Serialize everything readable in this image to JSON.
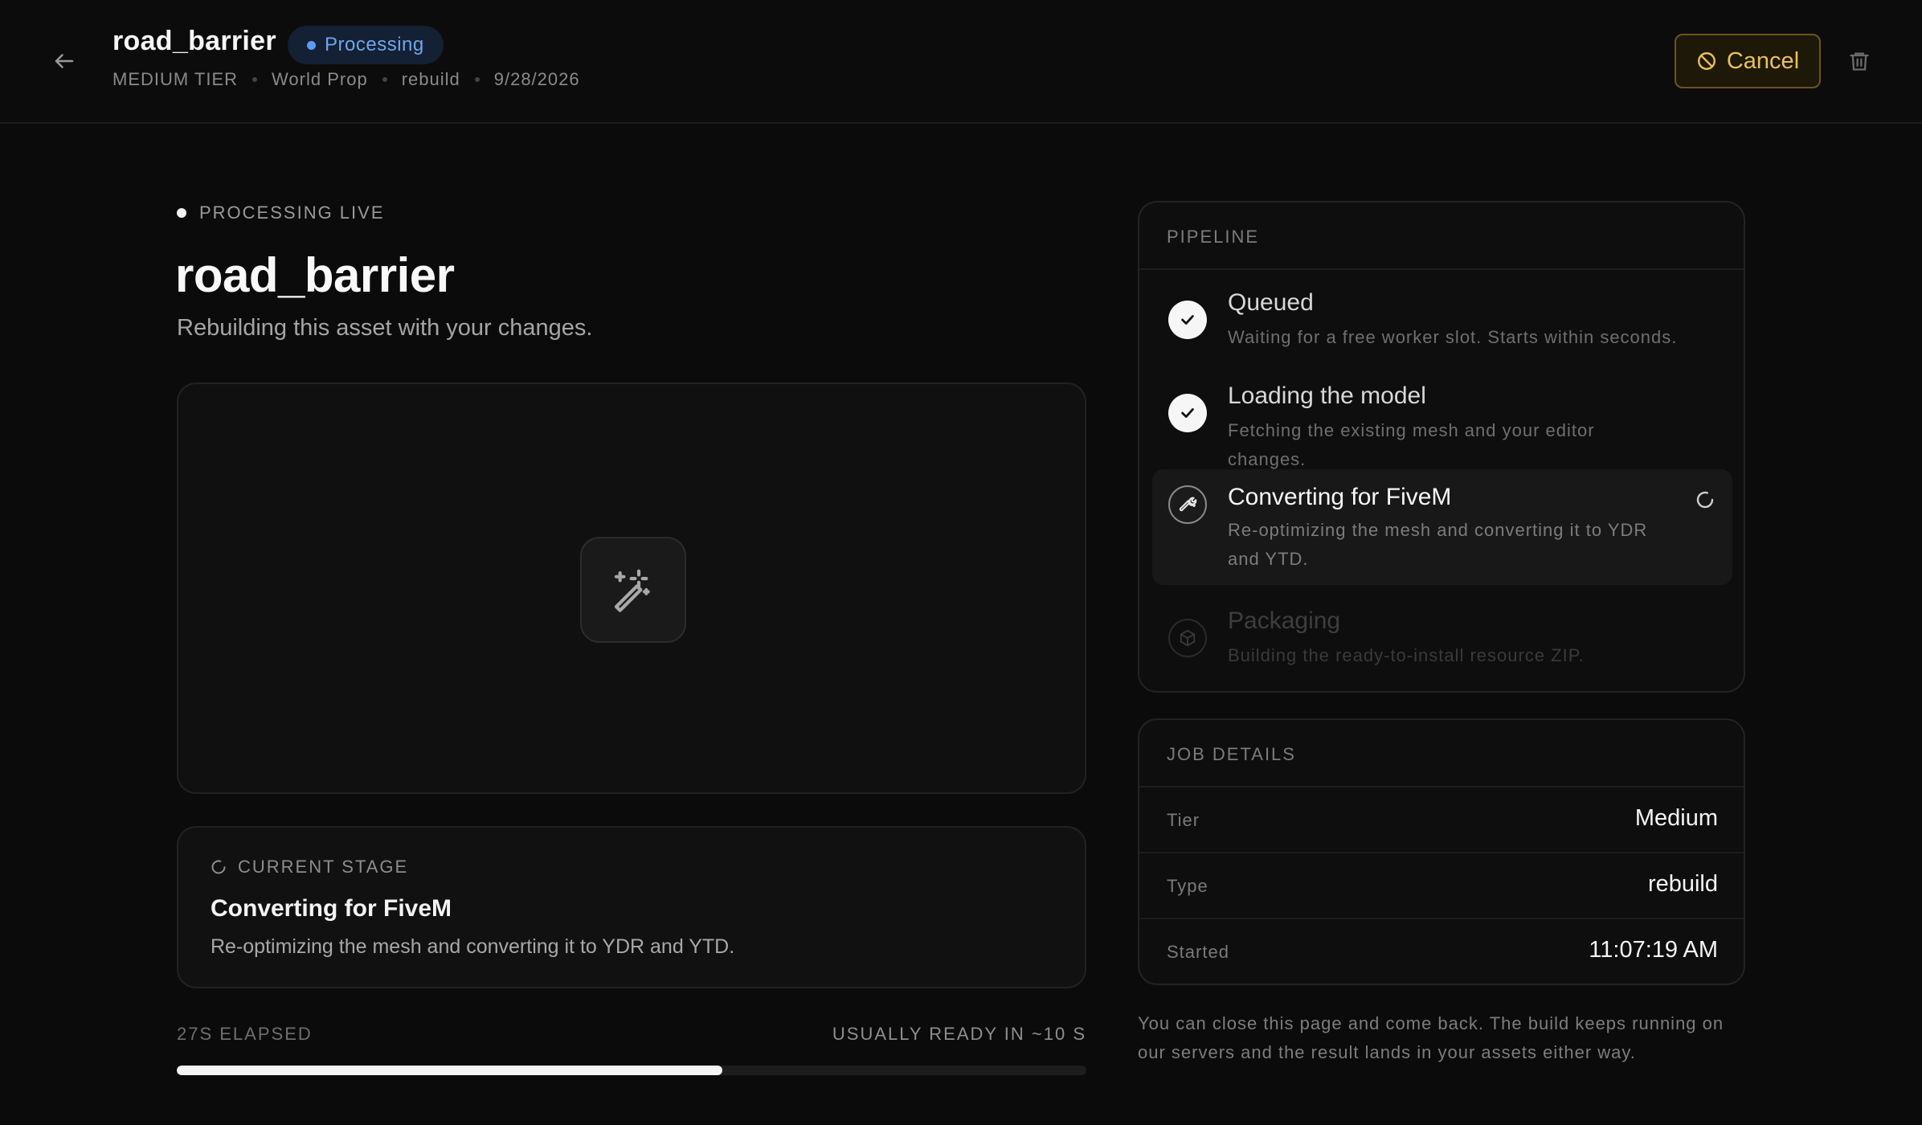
{
  "header": {
    "title": "road_barrier",
    "status": "Processing",
    "meta": [
      "MEDIUM TIER",
      "World Prop",
      "rebuild",
      "9/28/2026"
    ],
    "cancel_label": "Cancel",
    "icons": {
      "back": "arrow-left-icon",
      "cancel": "ban-icon",
      "delete": "trash-icon"
    },
    "colors": {
      "status_accent": "#5b9cf0",
      "cancel_accent": "#e8c15a"
    }
  },
  "main": {
    "live_label": "PROCESSING LIVE",
    "title": "road_barrier",
    "subtitle": "Rebuilding this asset with your changes.",
    "preview_icon": "magic-wand-icon",
    "current_stage": {
      "label": "CURRENT STAGE",
      "title": "Converting for FiveM",
      "description": "Re-optimizing the mesh and converting it to YDR and YTD."
    },
    "elapsed": "27S ELAPSED",
    "ready_hint": "USUALLY READY IN ~10 S",
    "progress": 0.6
  },
  "pipeline": {
    "heading": "PIPELINE",
    "steps": [
      {
        "title": "Queued",
        "description": "Waiting for a free worker slot. Starts within seconds.",
        "state": "done"
      },
      {
        "title": "Loading the model",
        "description": "Fetching the existing mesh and your editor changes.",
        "state": "done"
      },
      {
        "title": "Converting for FiveM",
        "description": "Re-optimizing the mesh and converting it to YDR and YTD.",
        "state": "active"
      },
      {
        "title": "Packaging",
        "description": "Building the ready-to-install resource ZIP.",
        "state": "pending"
      }
    ]
  },
  "details": {
    "heading": "JOB DETAILS",
    "rows": [
      {
        "key": "Tier",
        "value": "Medium"
      },
      {
        "key": "Type",
        "value": "rebuild"
      },
      {
        "key": "Started",
        "value": "11:07:19 AM"
      }
    ]
  },
  "note": "You can close this page and come back. The build keeps running on our servers and the result lands in your assets either way."
}
